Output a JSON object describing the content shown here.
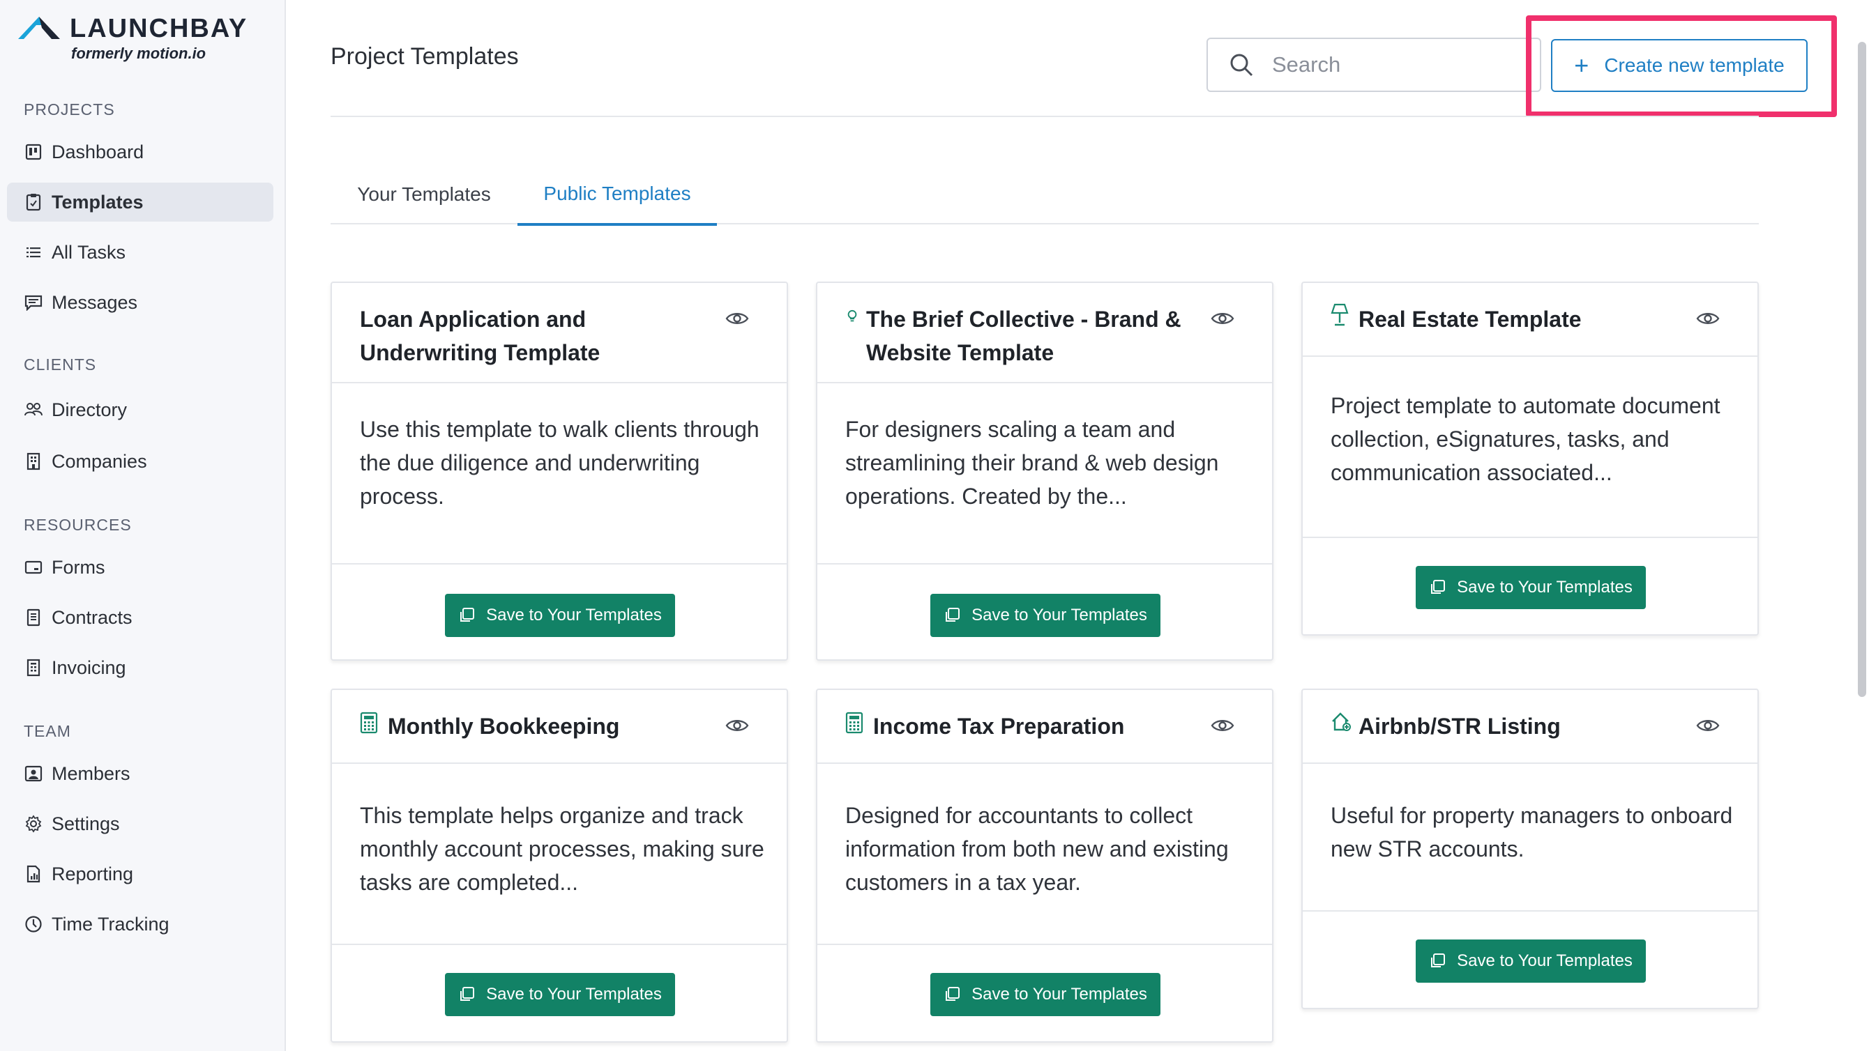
{
  "brand": {
    "name": "LAUNCHBAY",
    "subtitle": "formerly motion.io",
    "accent": "#1aa3d9"
  },
  "sidebar": {
    "sections": [
      {
        "title": "PROJECTS",
        "items": [
          {
            "label": "Dashboard",
            "icon": "dashboard-icon",
            "active": false
          },
          {
            "label": "Templates",
            "icon": "clipboard-icon",
            "active": true
          },
          {
            "label": "All Tasks",
            "icon": "list-icon",
            "active": false
          },
          {
            "label": "Messages",
            "icon": "message-icon",
            "active": false
          }
        ]
      },
      {
        "title": "CLIENTS",
        "items": [
          {
            "label": "Directory",
            "icon": "people-icon",
            "active": false
          },
          {
            "label": "Companies",
            "icon": "building-icon",
            "active": false
          }
        ]
      },
      {
        "title": "RESOURCES",
        "items": [
          {
            "label": "Forms",
            "icon": "form-icon",
            "active": false
          },
          {
            "label": "Contracts",
            "icon": "document-icon",
            "active": false
          },
          {
            "label": "Invoicing",
            "icon": "invoice-icon",
            "active": false
          }
        ]
      },
      {
        "title": "TEAM",
        "items": [
          {
            "label": "Members",
            "icon": "member-icon",
            "active": false
          },
          {
            "label": "Settings",
            "icon": "gear-icon",
            "active": false
          },
          {
            "label": "Reporting",
            "icon": "report-icon",
            "active": false
          },
          {
            "label": "Time Tracking",
            "icon": "clock-icon",
            "active": false
          }
        ]
      }
    ]
  },
  "header": {
    "title": "Project Templates",
    "search_placeholder": "Search",
    "create_label": "Create new template",
    "highlight_color": "#f0306c"
  },
  "tabs": [
    {
      "label": "Your Templates",
      "active": false
    },
    {
      "label": "Public Templates",
      "active": true
    }
  ],
  "cards": [
    {
      "title": "Loan Application and Underwriting Template",
      "icon": "",
      "description": "Use this template to walk clients through the due diligence and underwriting process.",
      "button": "Save to Your Templates"
    },
    {
      "title": "The Brief Collective - Brand & Website Template",
      "icon": "bulb-icon",
      "description": "For designers scaling a team and streamlining their brand & web design operations. Created by the...",
      "button": "Save to Your Templates"
    },
    {
      "title": "Real Estate Template",
      "icon": "lamp-icon",
      "description": "Project template to automate document collection, eSignatures, tasks, and communication associated...",
      "button": "Save to Your Templates"
    },
    {
      "title": "Monthly Bookkeeping",
      "icon": "calculator-icon",
      "description": "This template helps organize and track monthly account processes, making sure tasks are completed...",
      "button": "Save to Your Templates"
    },
    {
      "title": "Income Tax Preparation",
      "icon": "calculator-icon",
      "description": "Designed for accountants to collect information from both new and existing customers in a tax year.",
      "button": "Save to Your Templates"
    },
    {
      "title": "Airbnb/STR Listing",
      "icon": "house-icon",
      "description": "Useful for property managers to onboard new STR accounts.",
      "button": "Save to Your Templates"
    }
  ],
  "colors": {
    "primary": "#1f7fc4",
    "button_green": "#128266",
    "icon_green": "#1a8a6e"
  }
}
